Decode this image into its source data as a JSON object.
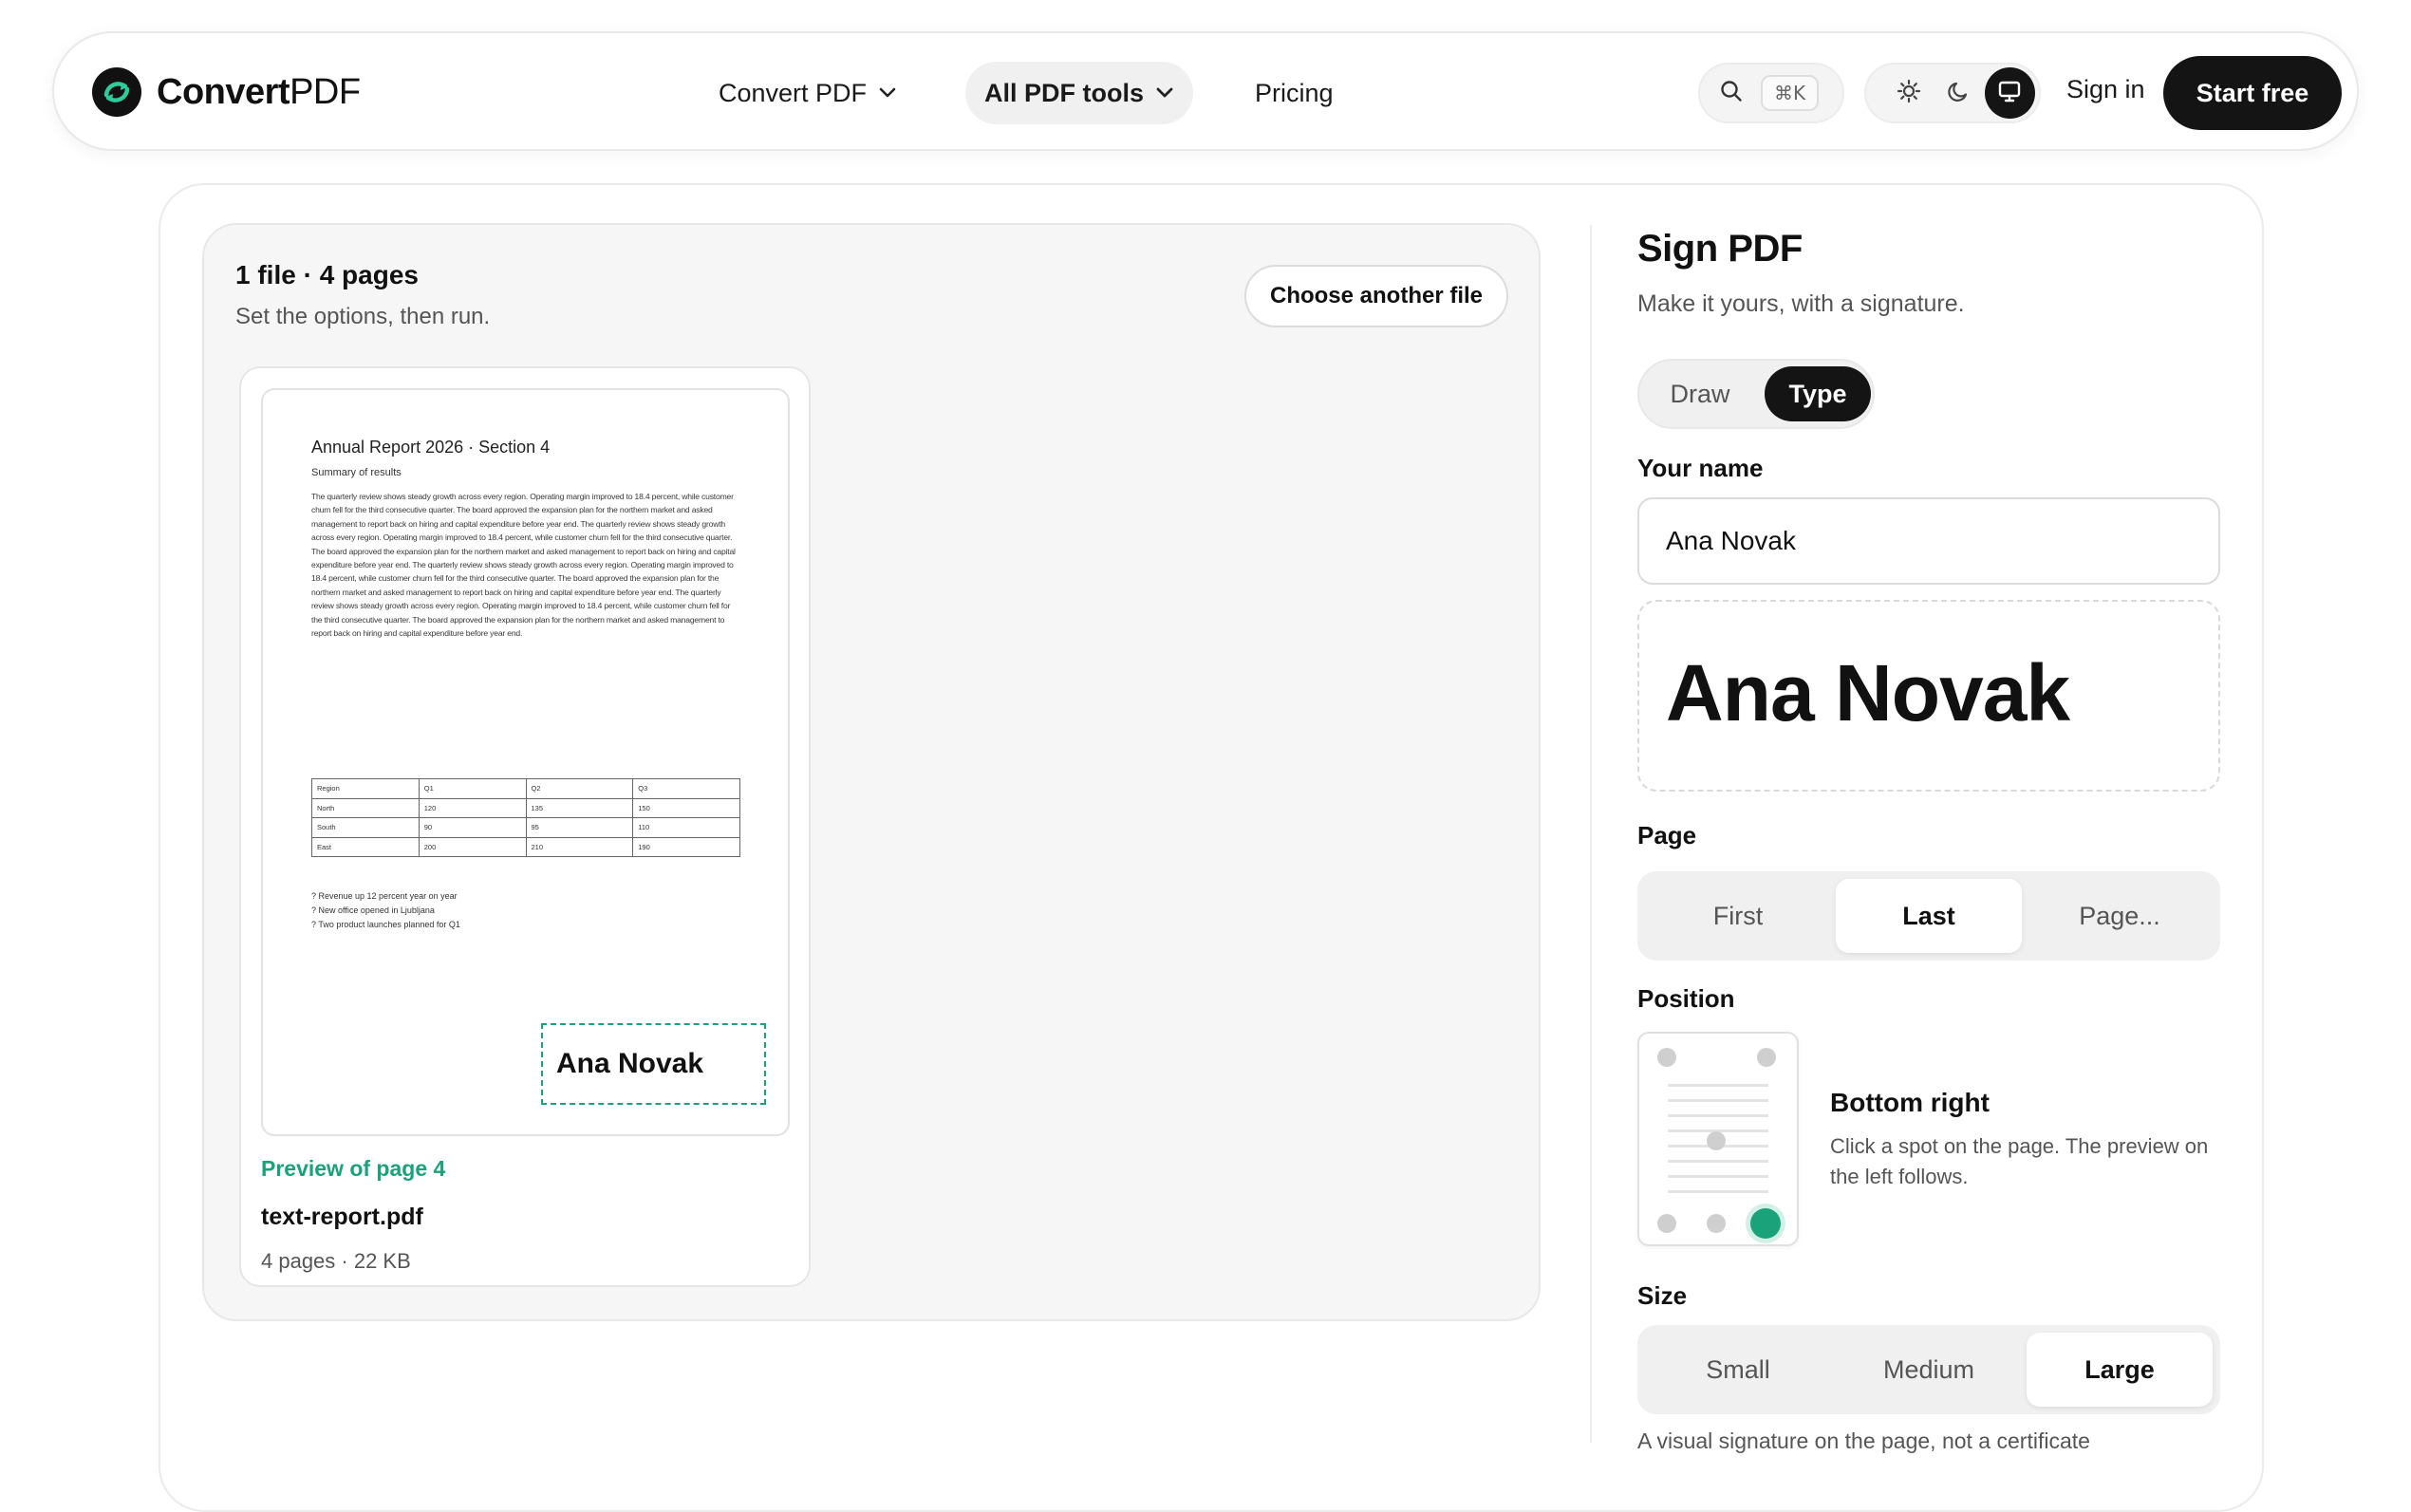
{
  "nav": {
    "brand_bold": "Convert",
    "brand_regular": "PDF",
    "items": [
      {
        "label": "Convert PDF"
      },
      {
        "label": "All PDF tools"
      },
      {
        "label": "Pricing"
      }
    ],
    "search_shortcut": "⌘K",
    "theme_options": [
      "light-icon",
      "dark-icon",
      "system-icon"
    ],
    "theme_selected": "system",
    "signin_label": "Sign in",
    "start_label": "Start free"
  },
  "files": {
    "title": "1 file · 4 pages",
    "subtitle": "Set the options, then run.",
    "choose_label": "Choose another file",
    "preview": {
      "doc_title": "Annual Report 2026 · Section 4",
      "doc_subtitle": "Summary of results",
      "doc_body": "The quarterly review shows steady growth across every region. Operating margin improved to 18.4 percent, while customer churn fell for the third consecutive quarter. The board approved the expansion plan for the northern market and asked management to report back on hiring and capital expenditure before year end. The quarterly review shows steady growth across every region. Operating margin improved to 18.4 percent, while customer churn fell for the third consecutive quarter. The board approved the expansion plan for the northern market and asked management to report back on hiring and capital expenditure before year end. The quarterly review shows steady growth across every region. Operating margin improved to 18.4 percent, while customer churn fell for the third consecutive quarter. The board approved the expansion plan for the northern market and asked management to report back on hiring and capital expenditure before year end. The quarterly review shows steady growth across every region. Operating margin improved to 18.4 percent, while customer churn fell for the third consecutive quarter. The board approved the expansion plan for the northern market and asked management to report back on hiring and capital expenditure before year end.",
      "table": [
        [
          "Region",
          "Q1",
          "Q2",
          "Q3"
        ],
        [
          "North",
          "120",
          "135",
          "150"
        ],
        [
          "South",
          "90",
          "95",
          "110"
        ],
        [
          "East",
          "200",
          "210",
          "190"
        ]
      ],
      "bullets": [
        "? Revenue up 12 percent year on year",
        "? New office opened in Ljubljana",
        "? Two product launches planned for Q1"
      ],
      "signature": "Ana Novak"
    },
    "preview_caption": "Preview of page 4",
    "file_name": "text-report.pdf",
    "file_meta": "4 pages · 22 KB"
  },
  "sign": {
    "title": "Sign PDF",
    "subtitle": "Make it yours, with a signature.",
    "modes": [
      "Draw",
      "Type"
    ],
    "mode_selected": "Type",
    "name_label": "Your name",
    "name_value": "Ana Novak",
    "signature_preview": "Ana Novak",
    "page_label": "Page",
    "page_options": [
      "First",
      "Last",
      "Page..."
    ],
    "page_selected": "Last",
    "position_label": "Position",
    "position_selected": "bottom-right",
    "position_name": "Bottom right",
    "position_desc": "Click a spot on the page. The preview on the left follows.",
    "size_label": "Size",
    "size_options": [
      "Small",
      "Medium",
      "Large"
    ],
    "size_selected": "Large",
    "footnote": "A visual signature on the page, not a certificate"
  },
  "colors": {
    "accent": "#1aa37a",
    "dark": "#141414",
    "panel_bg": "#f6f6f6"
  }
}
